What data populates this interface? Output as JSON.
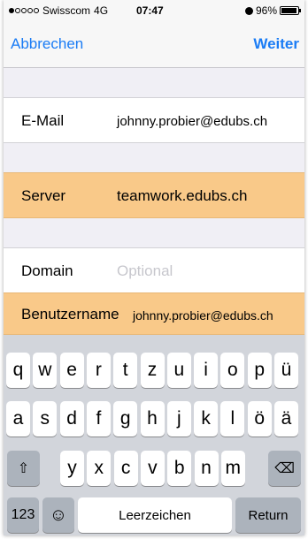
{
  "status_bar": {
    "carrier": "Swisscom",
    "network": "4G",
    "time": "07:47",
    "battery_percent": "96%",
    "signal_bars": 1,
    "battery_level": 0.96
  },
  "nav": {
    "cancel_label": "Abbrechen",
    "next_label": "Weiter"
  },
  "form": {
    "email": {
      "label": "E-Mail",
      "value": "johnny.probier@edubs.ch"
    },
    "server": {
      "label": "Server",
      "value": "teamwork.edubs.ch"
    },
    "domain": {
      "label": "Domain",
      "placeholder": "Optional"
    },
    "username": {
      "label": "Benutzername",
      "value": "johnny.probier@edubs.ch"
    }
  },
  "keyboard": {
    "row1": [
      "q",
      "w",
      "e",
      "r",
      "t",
      "z",
      "u",
      "i",
      "o",
      "p",
      "ü"
    ],
    "row2": [
      "a",
      "s",
      "d",
      "f",
      "g",
      "h",
      "j",
      "k",
      "l",
      "ö",
      "ä"
    ],
    "row3": [
      "y",
      "x",
      "c",
      "v",
      "b",
      "n",
      "m"
    ],
    "shift_symbol": "⇧",
    "delete_symbol": "⌫",
    "numbers_label": "123",
    "emoji_symbol": "☺",
    "space_label": "Leerzeichen",
    "return_label": "Return"
  },
  "colors": {
    "accent": "#1a7cf5",
    "highlight": "#f9c989",
    "keyboard_bg": "#d2d5db"
  }
}
